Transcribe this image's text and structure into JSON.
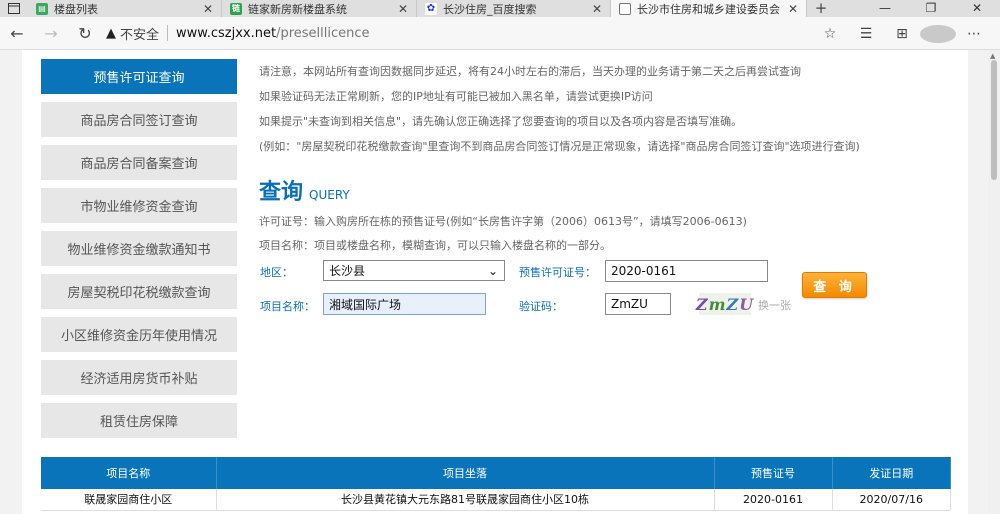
{
  "browser": {
    "tabs": [
      {
        "title": "楼盘列表",
        "favicon": "document-icon",
        "active": false
      },
      {
        "title": "链家新房新楼盘系统",
        "favicon": "lianjia-icon",
        "active": false
      },
      {
        "title": "长沙住房_百度搜索",
        "favicon": "baidu-icon",
        "active": false
      },
      {
        "title": "长沙市住房和城乡建设委员会",
        "favicon": "page-icon",
        "active": true
      }
    ],
    "security_label": "不安全",
    "url_host": "www.cszjxx.net",
    "url_path": "/preselllicence"
  },
  "sidebar": {
    "items": [
      {
        "label": "预售许可证查询",
        "active": true
      },
      {
        "label": "商品房合同签订查询",
        "active": false
      },
      {
        "label": "商品房合同备案查询",
        "active": false
      },
      {
        "label": "市物业维修资金查询",
        "active": false
      },
      {
        "label": "物业维修资金缴款通知书",
        "active": false
      },
      {
        "label": "房屋契税印花税缴款查询",
        "active": false
      },
      {
        "label": "小区维修资金历年使用情况",
        "active": false
      },
      {
        "label": "经济适用房货币补贴",
        "active": false
      },
      {
        "label": "租赁住房保障",
        "active": false
      }
    ]
  },
  "notice": [
    "请注意，本网站所有查询因数据同步延迟，将有24小时左右的滞后，当天办理的业务请于第二天之后再尝试查询",
    "如果验证码无法正常刷新，您的IP地址有可能已被加入黑名单，请尝试更换IP访问",
    "如果提示\"未查询到相关信息\"，请先确认您正确选择了您要查询的项目以及各项内容是否填写准确。",
    "(例如：\"房屋契税印花税缴款查询\"里查询不到商品房合同签订情况是正常现象，请选择\"商品房合同签订查询\"选项进行查询)"
  ],
  "query": {
    "title_cn": "查询",
    "title_en": "QUERY",
    "hint_license": "许可证号：输入购房所在栋的预售证号(例如“长房售许字第（2006）0613号”，请填写2006-0613)",
    "hint_project": "项目名称：项目或楼盘名称，模糊查询，可以只输入楼盘名称的一部分。",
    "district_label": "地区：",
    "district_value": "长沙县",
    "license_label": "预售许可证号：",
    "license_value": "2020-0161",
    "project_label": "项目名称：",
    "project_value": "湘域国际广场",
    "captcha_label": "验证码：",
    "captcha_value": "ZmZU",
    "captcha_image_text": [
      "Z",
      "m",
      "Z",
      "U"
    ],
    "refresh_label": "换一张",
    "submit_label": "查 询"
  },
  "results": {
    "headers": [
      "项目名称",
      "项目坐落",
      "预售证号",
      "发证日期"
    ],
    "rows": [
      [
        "联晟家园商住小区",
        "长沙县黄花镇大元东路81号联晟家园商住小区10栋",
        "2020-0161",
        "2020/07/16"
      ]
    ]
  },
  "colors": {
    "accent": "#0a74ba",
    "button": "#f28a00"
  }
}
